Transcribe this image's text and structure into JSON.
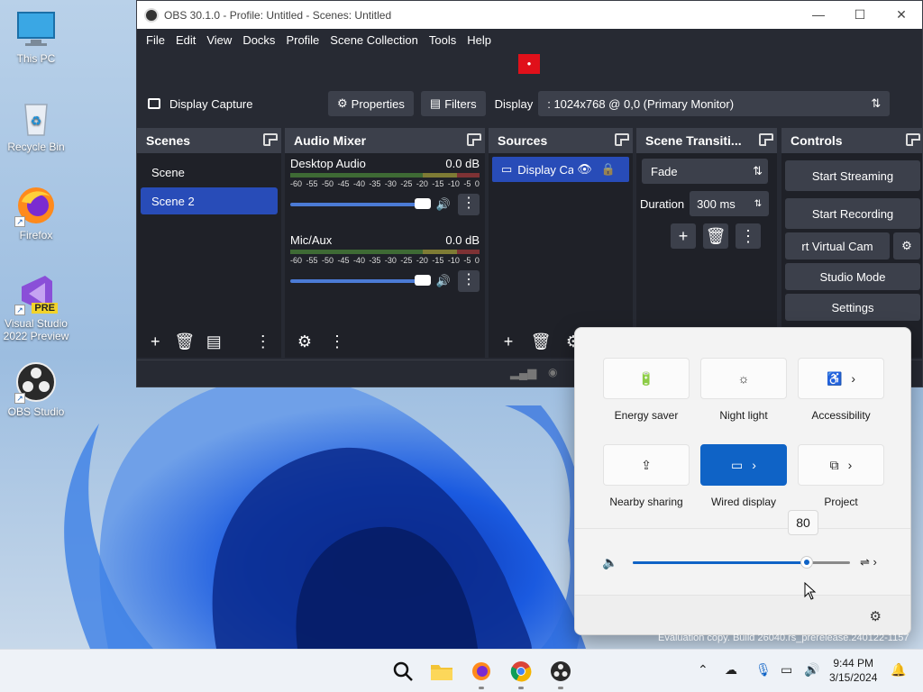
{
  "desktop": {
    "icons": [
      {
        "label": "This PC"
      },
      {
        "label": "Recycle Bin"
      },
      {
        "label": "Firefox"
      },
      {
        "label": "Visual Studio 2022 Preview",
        "badge": "PRE"
      },
      {
        "label": "OBS Studio"
      }
    ],
    "watermark": "Evaluation copy. Build 26040.rs_prerelease.240122-1157"
  },
  "obs": {
    "title": "OBS 30.1.0 - Profile: Untitled - Scenes: Untitled",
    "menu": [
      "File",
      "Edit",
      "View",
      "Docks",
      "Profile",
      "Scene Collection",
      "Tools",
      "Help"
    ],
    "source_bar": {
      "source_name": "Display Capture",
      "properties": "Properties",
      "filters": "Filters",
      "display_label": "Display",
      "display_value": ": 1024x768 @ 0,0 (Primary Monitor)"
    },
    "docks": {
      "scenes": {
        "title": "Scenes",
        "items": [
          "Scene",
          "Scene 2"
        ],
        "selected_index": 1
      },
      "audio_mixer": {
        "title": "Audio Mixer",
        "channels": [
          {
            "name": "Desktop Audio",
            "level": "0.0 dB"
          },
          {
            "name": "Mic/Aux",
            "level": "0.0 dB"
          }
        ],
        "ticks": [
          "-60",
          "-55",
          "-50",
          "-45",
          "-40",
          "-35",
          "-30",
          "-25",
          "-20",
          "-15",
          "-10",
          "-5",
          "0"
        ]
      },
      "sources": {
        "title": "Sources",
        "items": [
          "Display Ca"
        ]
      },
      "scene_transitions": {
        "title": "Scene Transiti...",
        "transition": "Fade",
        "duration_label": "Duration",
        "duration_value": "300 ms"
      },
      "controls": {
        "title": "Controls",
        "buttons": [
          "Start Streaming",
          "Start Recording",
          "rt Virtual Cam",
          "Studio Mode",
          "Settings"
        ]
      }
    }
  },
  "quick_settings": {
    "tiles": [
      {
        "label": "Energy saver",
        "icon": "energy-saver-icon",
        "active": false
      },
      {
        "label": "Night light",
        "icon": "night-light-icon",
        "active": false
      },
      {
        "label": "Accessibility",
        "icon": "accessibility-icon",
        "active": false
      },
      {
        "label": "Nearby sharing",
        "icon": "share-icon",
        "active": false
      },
      {
        "label": "Wired display",
        "icon": "cast-icon",
        "active": true
      },
      {
        "label": "Project",
        "icon": "project-icon",
        "active": false
      }
    ],
    "volume": {
      "value": "80",
      "level": 0.8
    }
  },
  "taskbar": {
    "time": "9:44 PM",
    "date": "3/15/2024"
  }
}
